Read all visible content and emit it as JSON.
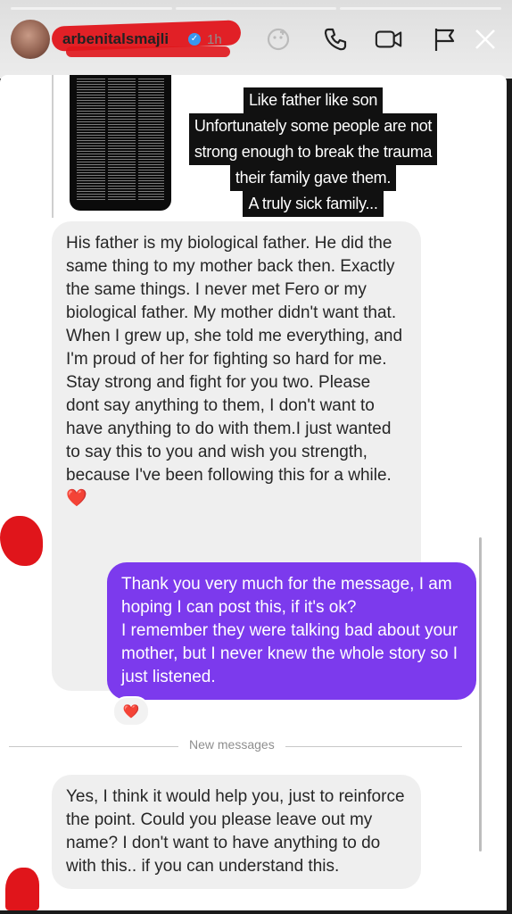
{
  "header": {
    "username": "arbenitalsmajli",
    "time": "1h",
    "icons": [
      "effects-icon",
      "phone-icon",
      "video-icon",
      "flag-icon",
      "close-icon"
    ]
  },
  "story": {
    "caption_lines": [
      "Like father like son",
      "Unfortunately some people are not",
      "strong enough to break the trauma",
      "their family gave them.",
      "A truly sick family..."
    ]
  },
  "messages": [
    {
      "sender": "them",
      "text": "His father is my biological father. He did the same thing to my mother back then. Exactly the same things. I never met Fero or my biological father. My mother didn't want that. When I grew up, she told me everything, and I'm proud of her for fighting so hard for me. Stay strong and fight for you two. Please dont say anything to them, I don't want to have anything to do with them.I just wanted to say this to you and wish you strength, because I've been following this for a while. ❤️"
    },
    {
      "sender": "me",
      "text": "Thank you very much for the message, I am hoping I can post this, if it's ok?\nI remember they were talking bad about your mother, but I never knew the whole story so I just listened.",
      "reaction": "❤️"
    },
    {
      "sender": "them",
      "text": "Yes, I think it would help you, just to reinforce the point. Could you please leave out my name? I don't want to have anything to do with this.. if you can understand this."
    }
  ],
  "divider": {
    "label": "New messages"
  },
  "colors": {
    "accent": "#7c3aed",
    "incoming_bg": "#efefef",
    "redaction": "#e0151b"
  }
}
